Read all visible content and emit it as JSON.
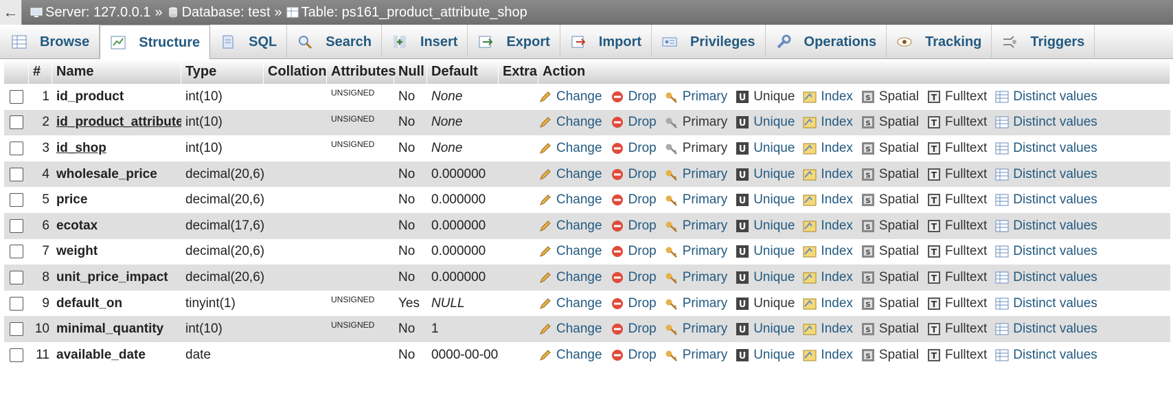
{
  "breadcrumb": {
    "back": "←",
    "server": "Server: 127.0.0.1",
    "database": "Database: test",
    "table": "Table: ps161_product_attribute_shop",
    "sep": "»"
  },
  "tabs": [
    {
      "label": "Browse"
    },
    {
      "label": "Structure"
    },
    {
      "label": "SQL"
    },
    {
      "label": "Search"
    },
    {
      "label": "Insert"
    },
    {
      "label": "Export"
    },
    {
      "label": "Import"
    },
    {
      "label": "Privileges"
    },
    {
      "label": "Operations"
    },
    {
      "label": "Tracking"
    },
    {
      "label": "Triggers"
    }
  ],
  "columns": {
    "num": "#",
    "name": "Name",
    "type": "Type",
    "collation": "Collation",
    "attributes": "Attributes",
    "null": "Null",
    "default": "Default",
    "extra": "Extra",
    "action": "Action"
  },
  "actions": {
    "change": "Change",
    "drop": "Drop",
    "primary": "Primary",
    "unique": "Unique",
    "index": "Index",
    "spatial": "Spatial",
    "fulltext": "Fulltext",
    "distinct": "Distinct values"
  },
  "rows": [
    {
      "num": "1",
      "name": "id_product",
      "type": "int(10)",
      "attr": "UNSIGNED",
      "null": "No",
      "default": "None"
    },
    {
      "num": "2",
      "name": "id_product_attribute",
      "type": "int(10)",
      "attr": "UNSIGNED",
      "null": "No",
      "default": "None"
    },
    {
      "num": "3",
      "name": "id_shop",
      "type": "int(10)",
      "attr": "UNSIGNED",
      "null": "No",
      "default": "None"
    },
    {
      "num": "4",
      "name": "wholesale_price",
      "type": "decimal(20,6)",
      "attr": "",
      "null": "No",
      "default": "0.000000"
    },
    {
      "num": "5",
      "name": "price",
      "type": "decimal(20,6)",
      "attr": "",
      "null": "No",
      "default": "0.000000"
    },
    {
      "num": "6",
      "name": "ecotax",
      "type": "decimal(17,6)",
      "attr": "",
      "null": "No",
      "default": "0.000000"
    },
    {
      "num": "7",
      "name": "weight",
      "type": "decimal(20,6)",
      "attr": "",
      "null": "No",
      "default": "0.000000"
    },
    {
      "num": "8",
      "name": "unit_price_impact",
      "type": "decimal(20,6)",
      "attr": "",
      "null": "No",
      "default": "0.000000"
    },
    {
      "num": "9",
      "name": "default_on",
      "type": "tinyint(1)",
      "attr": "UNSIGNED",
      "null": "Yes",
      "default": "NULL"
    },
    {
      "num": "10",
      "name": "minimal_quantity",
      "type": "int(10)",
      "attr": "UNSIGNED",
      "null": "No",
      "default": "1"
    },
    {
      "num": "11",
      "name": "available_date",
      "type": "date",
      "attr": "",
      "null": "No",
      "default": "0000-00-00"
    }
  ]
}
